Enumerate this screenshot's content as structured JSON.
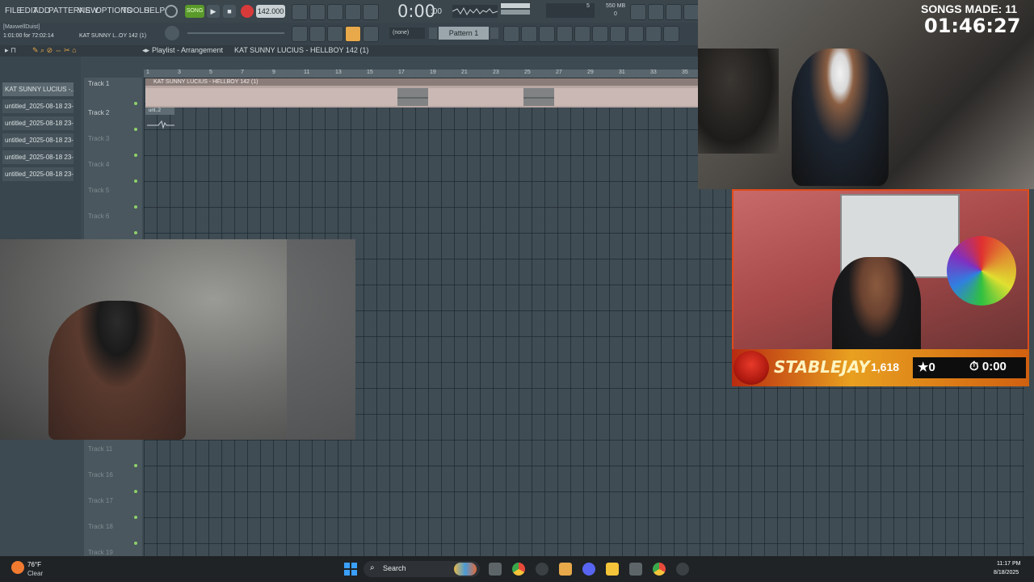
{
  "menu": {
    "items": [
      "FILE",
      "EDIT",
      "ADD",
      "PATTERNS",
      "VIEW",
      "OPTIONS",
      "TOOLS",
      "HELP"
    ]
  },
  "transport": {
    "mode": "SONG",
    "tempo": "142.000",
    "time": "0:00",
    "time_frac": ":00",
    "mem": "550 MB",
    "mem_small": "0",
    "cpu_num": "5"
  },
  "info": {
    "user": "[MaxwellDuist]",
    "position": "1:01:00 for 72:02:14",
    "file": "KAT SUNNY L..OY 142 (1)"
  },
  "patterns": {
    "none_label": "(none)",
    "pattern_label": "Pattern 1"
  },
  "playlist": {
    "breadcrumb": "Playlist - Arrangement",
    "breadcrumb_file": "KAT SUNNY LUCIUS - HELLBOY 142 (1)",
    "clip1": "KAT SUNNY LUCIUS - HELLBOY 142 (1)",
    "clip2": "unt..2"
  },
  "browser": {
    "items": [
      "KAT SUNNY LUCIUS -..",
      "untitled_2025-08-18 23-..",
      "untitled_2025-08-18 23-..",
      "untitled_2025-08-18 23-..",
      "untitled_2025-08-18 23-..",
      "untitled_2025-08-18 23-.."
    ]
  },
  "tracks": {
    "top": [
      "Track 1",
      "Track 2",
      "Track 3",
      "Track 4",
      "Track 5",
      "Track 6"
    ],
    "bottom": [
      "Track 11",
      "Track 16",
      "Track 17",
      "Track 18",
      "Track 19"
    ]
  },
  "timeline": {
    "ticks": [
      "1",
      "3",
      "5",
      "7",
      "9",
      "11",
      "13",
      "15",
      "17",
      "19",
      "21",
      "23",
      "25",
      "27",
      "29",
      "31",
      "33",
      "35"
    ]
  },
  "stream": {
    "songs_made_label": "SONGS MADE: 11",
    "timer": "01:46:27",
    "overlay_name": "STABLEJAY",
    "overlay_count": "1,618",
    "overlay_star": "★0",
    "overlay_time": "⏱ 0:00"
  },
  "taskbar": {
    "weather_temp": "76°F",
    "weather_desc": "Clear",
    "search_label": "Search",
    "clock_time": "11:17 PM",
    "clock_date": "8/18/2025"
  }
}
